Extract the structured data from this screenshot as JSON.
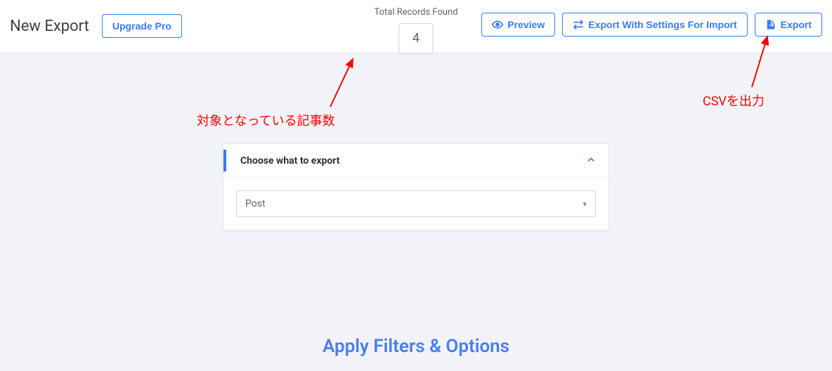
{
  "header": {
    "title": "New Export",
    "upgrade_label": "Upgrade Pro",
    "records_label": "Total Records Found",
    "records_count": "4",
    "preview_label": "Preview",
    "export_with_settings_label": "Export With Settings For Import",
    "export_label": "Export"
  },
  "card": {
    "title": "Choose what to export",
    "selected_post_type": "Post"
  },
  "filters_heading": "Apply Filters & Options",
  "annotations": {
    "records_note": "対象となっている記事数",
    "export_note": "CSVを出力"
  }
}
